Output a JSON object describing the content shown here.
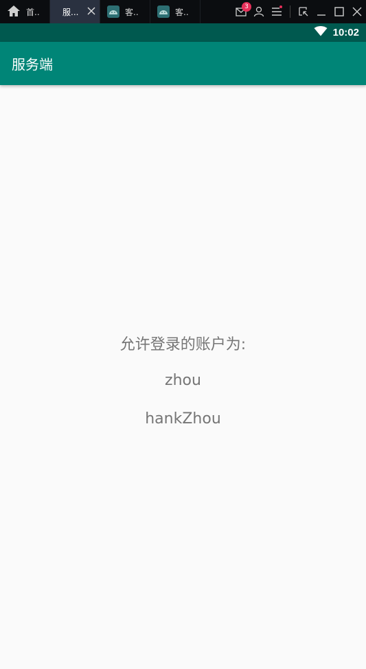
{
  "titlebar": {
    "tabs": [
      {
        "label": "首..",
        "icon": "home-icon",
        "active": false
      },
      {
        "label": "服...",
        "icon": "",
        "active": true
      },
      {
        "label": "客..",
        "icon": "android-app-icon",
        "active": false
      },
      {
        "label": "客..",
        "icon": "android-app-icon",
        "active": false
      }
    ],
    "mail_badge": "3"
  },
  "statusbar": {
    "time": "10:02"
  },
  "appbar": {
    "title": "服务端"
  },
  "content": {
    "heading": "允许登录的账户为:",
    "accounts": [
      "zhou",
      "hankZhou"
    ]
  },
  "colors": {
    "primary": "#008577",
    "primary_dark": "#00594f",
    "text_secondary": "#757575",
    "background": "#fafafa"
  }
}
